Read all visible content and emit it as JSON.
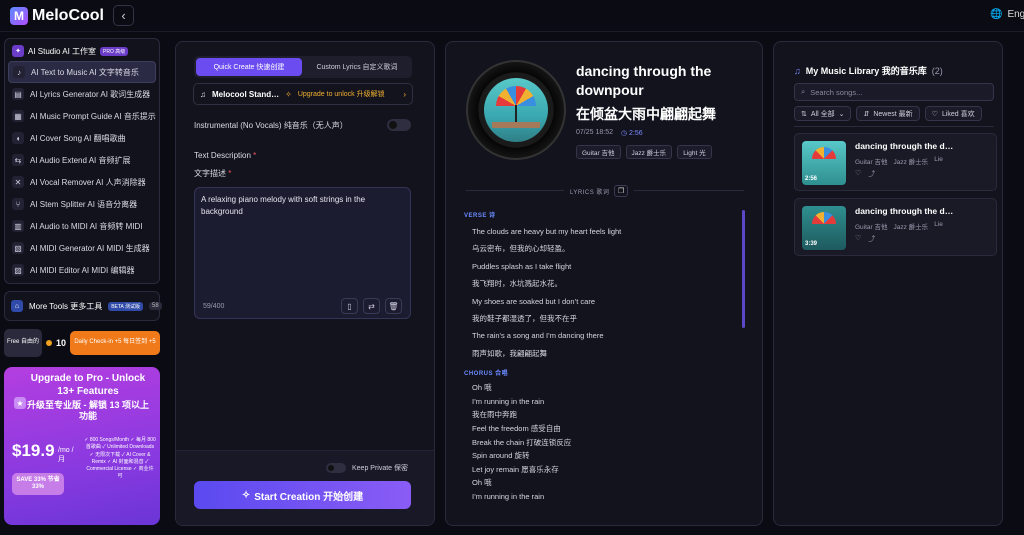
{
  "app": {
    "name": "MeloCool",
    "logo_letter": "M",
    "lang": "Eng"
  },
  "sidebar": {
    "header": {
      "title": "AI Studio  AI 工作室",
      "badge": "PRO 高级"
    },
    "items": [
      {
        "label": "AI Text to Music  AI 文字转音乐",
        "icon": "music-note-icon",
        "active": true
      },
      {
        "label": "AI Lyrics Generator  AI 歌词生成器",
        "icon": "document-icon"
      },
      {
        "label": "AI Music Prompt Guide  AI 音乐提示词指南",
        "icon": "guide-icon"
      },
      {
        "label": "AI Cover Song  AI 翻唱歌曲",
        "icon": "microphone-icon"
      },
      {
        "label": "AI Audio Extend  AI 音频扩展",
        "icon": "extend-icon"
      },
      {
        "label": "AI Vocal Remover  AI 人声消除器",
        "icon": "vocal-remove-icon"
      },
      {
        "label": "AI Stem Splitter  AI 语音分离器",
        "icon": "split-icon"
      },
      {
        "label": "AI Audio to MIDI  AI 音频转 MIDI",
        "icon": "midi-icon"
      },
      {
        "label": "AI MIDI Generator  AI MIDI 生成器",
        "icon": "midi-generator-icon"
      },
      {
        "label": "AI MIDI Editor  AI MIDI 编辑器",
        "icon": "midi-editor-icon"
      }
    ],
    "more_tools": {
      "label": "More Tools  更多工具",
      "beta": "BETA 测试版",
      "count": "58"
    },
    "credits": {
      "plan": "Free 自由的",
      "coins": "10",
      "checkin": "Daily Check-in +5  每日签到 +5"
    },
    "pro_card": {
      "title": "Upgrade to Pro - Unlock 13+ Features",
      "title_cn": "升级至专业版 - 解锁 13 项以上功能",
      "price": "$19.9",
      "per": "/mo /月",
      "save": "SAVE 33%  节省 33%",
      "features": "✓ 800 Songs/Month ✓ 每月 800 首歌曲 ✓ Unlimited Downloads ✓ 无限次下载 ✓ AI Cover & Remix ✓ AI 封面和混音 ✓ Commercial License ✓ 商业许可"
    }
  },
  "generator": {
    "tabs": [
      {
        "label": "Quick Create  快速创建",
        "active": true
      },
      {
        "label": "Custom Lyrics  自定义歌词"
      }
    ],
    "model": {
      "name": "Melocool Stand…",
      "upgrade": "Upgrade to unlock  升级解锁"
    },
    "instrumental_label": "Instrumental (No Vocals)  纯音乐（无人声）",
    "desc_label": "Text Description",
    "desc_label_cn": "文字描述",
    "description": "A relaxing piano melody with soft strings in the background",
    "char_count": "59/400",
    "keep_private": "Keep Private  保密",
    "start_button": "Start Creation  开始创建"
  },
  "song": {
    "title": "dancing through the downpour",
    "title_cn": "在倾盆大雨中翩翩起舞",
    "date": "07/25 18:52",
    "duration": "2:56",
    "tags": [
      "Guitar 吉他",
      "Jazz 爵士乐",
      "Light 光"
    ],
    "lyrics_label": "LYRICS 歌词",
    "verse_label": "VERSE 诗",
    "chorus_label": "CHORUS 合唱",
    "verse": [
      "The clouds are heavy but my heart feels light",
      "乌云密布，但我的心却轻盈。",
      "Puddles splash as I take flight",
      "我飞翔时，水坑溅起水花。",
      "My shoes are soaked but I don’t care",
      "我的鞋子都湿透了，但我不在乎",
      "The rain's a song and I’m dancing there",
      "雨声如歌，我翩翩起舞"
    ],
    "chorus": [
      "Oh 哦",
      "I’m running in the rain",
      "我在雨中奔跑",
      "Feel the freedom  感受自由",
      "Break the chain  打破连锁反应",
      "Spin around  旋转",
      "Let joy remain  愿喜乐永存",
      "Oh 哦",
      "I’m running in the rain"
    ]
  },
  "library": {
    "title": "My Music Library  我的音乐库",
    "count": "(2)",
    "search_placeholder": "Search songs...",
    "filters": {
      "all": "All 全部",
      "newest": "Newest 最新",
      "liked": "Liked 喜欢"
    },
    "songs": [
      {
        "title": "dancing through the d…",
        "duration": "2:56",
        "tags": [
          "Guitar 吉他",
          "Jazz 爵士乐",
          "Lie"
        ]
      },
      {
        "title": "dancing through the d…",
        "duration": "3:39",
        "tags": [
          "Guitar 吉他",
          "Jazz 爵士乐",
          "Lie"
        ]
      }
    ]
  },
  "colors": {
    "accent": "#6a4cf0",
    "pro_gradient": "#b43ee0",
    "checkin": "#f07a1a",
    "upgrade": "#f0b030"
  }
}
